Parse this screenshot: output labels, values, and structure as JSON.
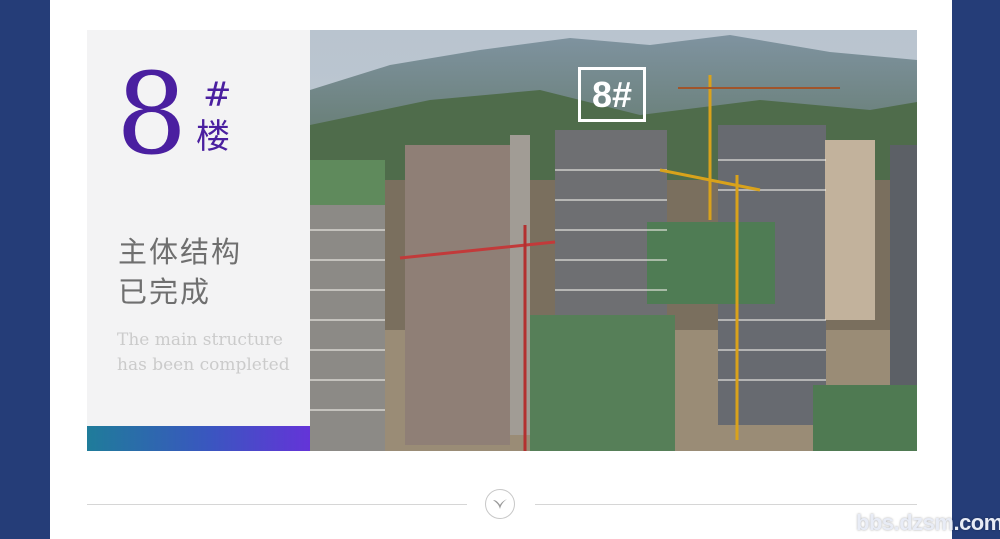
{
  "info": {
    "number": "8",
    "hash": "#",
    "building_char": "楼",
    "status_cn": "主体结构\n已完成",
    "status_en": "The main structure has been completed"
  },
  "photo": {
    "tag": "8#"
  },
  "footer": {
    "emblem_icon": "swallow-icon"
  },
  "watermark": "bbs.dzsm.com",
  "colors": {
    "accent": "#4a1fa0",
    "frame": "#253d78",
    "gradient_start": "#1f7c9a",
    "gradient_end": "#6434d8"
  }
}
